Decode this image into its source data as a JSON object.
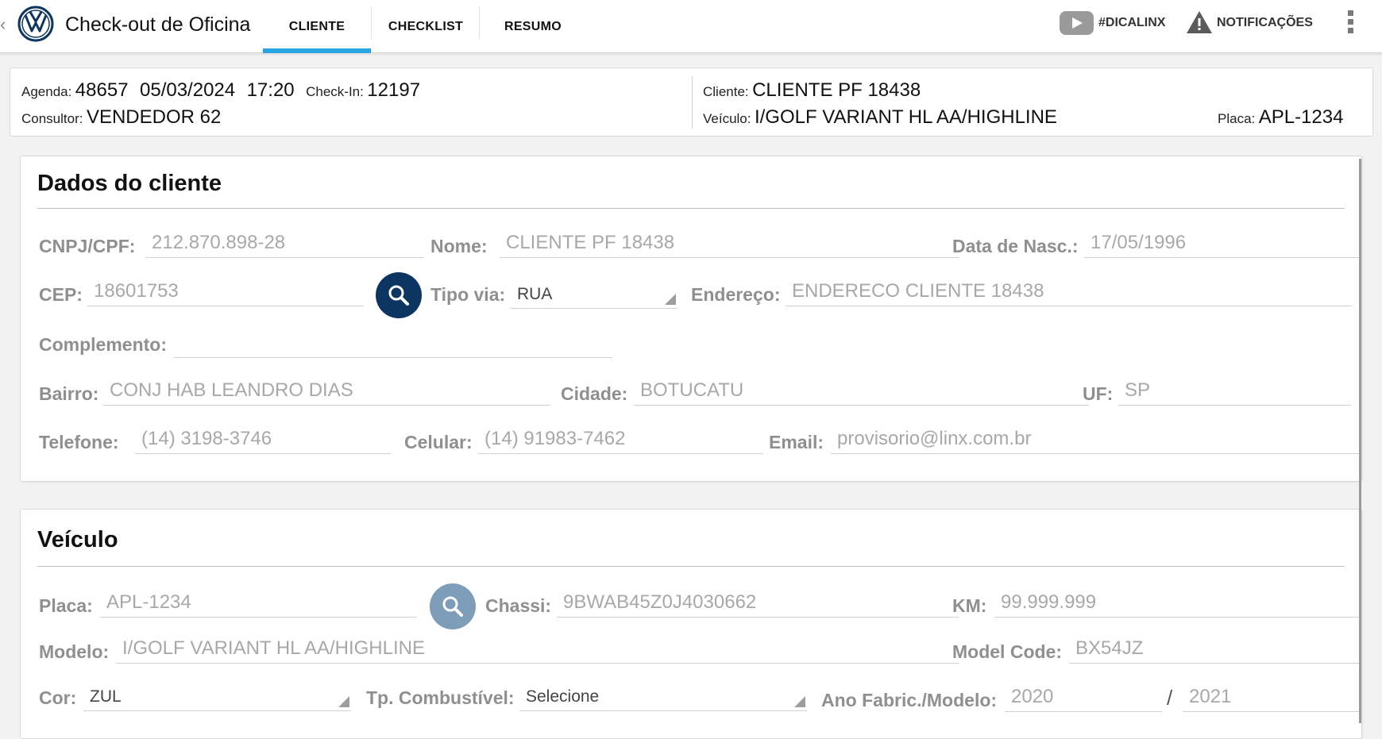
{
  "header": {
    "back_glyph": "‹",
    "app_title": "Check-out de Oficina",
    "tabs": [
      {
        "label": "CLIENTE",
        "active": true
      },
      {
        "label": "CHECKLIST",
        "active": false
      },
      {
        "label": "RESUMO",
        "active": false
      }
    ],
    "dica_label": "#DICALINX",
    "notifications_label": "NOTIFICAÇÕES",
    "accent_color": "#29a6e0"
  },
  "summary": {
    "agenda_label": "Agenda:",
    "agenda_number": "48657",
    "agenda_date": "05/03/2024",
    "agenda_time": "17:20",
    "checkin_label": "Check-In:",
    "checkin_value": "12197",
    "consultor_label": "Consultor:",
    "consultor_value": "VENDEDOR 62",
    "cliente_label": "Cliente:",
    "cliente_value": "CLIENTE PF 18438",
    "veiculo_label": "Veículo:",
    "veiculo_value": "I/GOLF VARIANT HL AA/HIGHLINE",
    "placa_label": "Placa:",
    "placa_value": "APL-1234"
  },
  "cliente_card": {
    "title": "Dados do cliente",
    "cnpj_label": "CNPJ/CPF:",
    "cnpj_value": "212.870.898-28",
    "nome_label": "Nome:",
    "nome_value": "CLIENTE PF 18438",
    "nasc_label": "Data de Nasc.:",
    "nasc_value": "17/05/1996",
    "cep_label": "CEP:",
    "cep_value": "18601753",
    "tipo_via_label": "Tipo via:",
    "tipo_via_value": "RUA",
    "endereco_label": "Endereço:",
    "endereco_value": "ENDERECO CLIENTE 18438",
    "complemento_label": "Complemento:",
    "complemento_value": "",
    "bairro_label": "Bairro:",
    "bairro_value": "CONJ HAB LEANDRO DIAS",
    "cidade_label": "Cidade:",
    "cidade_value": "BOTUCATU",
    "uf_label": "UF:",
    "uf_value": "SP",
    "telefone_label": "Telefone:",
    "telefone_value": "(14) 3198-3746",
    "celular_label": "Celular:",
    "celular_value": "(14) 91983-7462",
    "email_label": "Email:",
    "email_value": "provisorio@linx.com.br"
  },
  "veiculo_card": {
    "title": "Veículo",
    "placa_label": "Placa:",
    "placa_value": "APL-1234",
    "chassi_label": "Chassi:",
    "chassi_value": "9BWAB45Z0J4030662",
    "km_label": "KM:",
    "km_value": "99.999.999",
    "modelo_label": "Modelo:",
    "modelo_value": "I/GOLF VARIANT HL AA/HIGHLINE",
    "model_code_label": "Model Code:",
    "model_code_value": "BX54JZ",
    "cor_label": "Cor:",
    "cor_value": "ZUL",
    "combustivel_label": "Tp. Combustível:",
    "combustivel_value": "Selecione",
    "ano_label": "Ano Fabric./Modelo:",
    "ano_fabric_value": "2020",
    "ano_sep": "/",
    "ano_modelo_value": "2021"
  },
  "icons": {
    "logo": "vw-logo-icon",
    "video": "youtube-play-icon",
    "warning": "warning-triangle-icon",
    "menu": "kebab-menu-icon",
    "search": "search-icon"
  }
}
